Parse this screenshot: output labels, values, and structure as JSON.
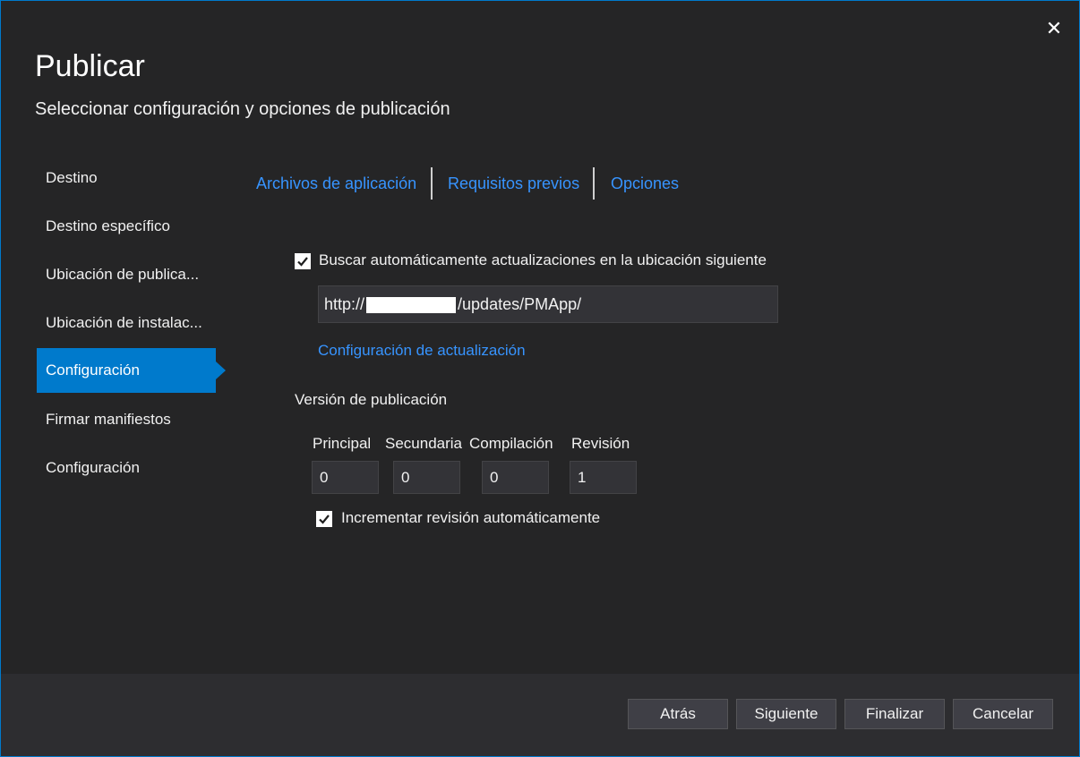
{
  "dialog": {
    "title": "Publicar",
    "subtitle": "Seleccionar configuración y opciones de publicación",
    "close_icon": "close-icon"
  },
  "sidebar": {
    "items": [
      {
        "label": "Destino",
        "active": false
      },
      {
        "label": "Destino específico",
        "active": false
      },
      {
        "label": "Ubicación de publica...",
        "active": false
      },
      {
        "label": "Ubicación de instalac...",
        "active": false
      },
      {
        "label": "Configuración",
        "active": true
      },
      {
        "label": "Firmar manifiestos",
        "active": false
      },
      {
        "label": "Configuración",
        "active": false
      }
    ]
  },
  "tabs": [
    {
      "label": "Archivos de aplicación"
    },
    {
      "label": "Requisitos previos"
    },
    {
      "label": "Opciones"
    }
  ],
  "updates": {
    "checkbox_label": "Buscar automáticamente actualizaciones en la ubicación siguiente",
    "checked": true,
    "url_prefix": "http://",
    "url_suffix": "/updates/PMApp/",
    "settings_link": "Configuración de actualización"
  },
  "version": {
    "heading": "Versión de publicación",
    "fields": [
      {
        "label": "Principal",
        "value": "0"
      },
      {
        "label": "Secundaria",
        "value": "0"
      },
      {
        "label": "Compilación",
        "value": "0"
      },
      {
        "label": "Revisión",
        "value": "1"
      }
    ],
    "auto_increment_label": "Incrementar revisión automáticamente",
    "auto_increment_checked": true
  },
  "buttons": {
    "back": "Atrás",
    "next": "Siguiente",
    "finish": "Finalizar",
    "cancel": "Cancelar"
  },
  "colors": {
    "accent": "#007acc",
    "link": "#3794ff",
    "background": "#252526",
    "footer": "#2d2d30"
  }
}
